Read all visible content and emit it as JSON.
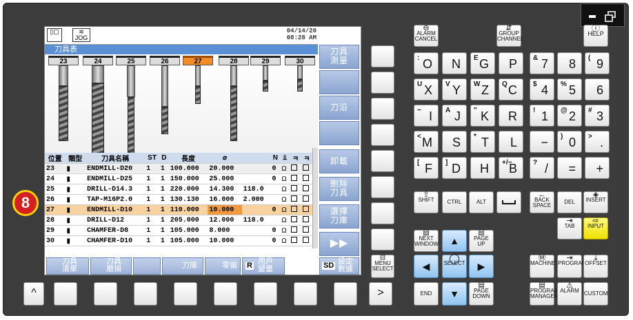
{
  "screen": {
    "date": "04/14/20",
    "time": "08:28 AM",
    "jog_label": "JOG",
    "title": "刀具表",
    "tools": [
      {
        "num": "23"
      },
      {
        "num": "24"
      },
      {
        "num": "25"
      },
      {
        "num": "26"
      },
      {
        "num": "27"
      },
      {
        "num": "28"
      },
      {
        "num": "29"
      },
      {
        "num": "30"
      }
    ],
    "headers": [
      "位置",
      "類型",
      "刀具名稱",
      "ST",
      "D",
      "長度",
      "⌀",
      "",
      "N",
      "",
      "",
      ""
    ],
    "rows": [
      {
        "pos": "23",
        "name": "ENDMILL-D20",
        "st": "1",
        "d": "1",
        "len": "100.000",
        "dia": "20.000",
        "r": "",
        "n": "0"
      },
      {
        "pos": "24",
        "name": "ENDMILL-D25",
        "st": "1",
        "d": "1",
        "len": "150.000",
        "dia": "25.000",
        "r": "",
        "n": "0"
      },
      {
        "pos": "25",
        "name": "DRILL-D14.3",
        "st": "1",
        "d": "1",
        "len": "220.000",
        "dia": "14.300",
        "r": "118.0",
        "n": ""
      },
      {
        "pos": "26",
        "name": "TAP-M16P2.0",
        "st": "1",
        "d": "1",
        "len": "130.130",
        "dia": "16.000",
        "r": "2.000",
        "n": ""
      },
      {
        "pos": "27",
        "name": "ENDMILL-D10",
        "st": "1",
        "d": "1",
        "len": "110.000",
        "dia": "10.000",
        "r": "",
        "n": "0"
      },
      {
        "pos": "28",
        "name": "DRILL-D12",
        "st": "1",
        "d": "1",
        "len": "205.000",
        "dia": "12.000",
        "r": "118.0",
        "n": ""
      },
      {
        "pos": "29",
        "name": "CHAMFER-D8",
        "st": "1",
        "d": "1",
        "len": "105.000",
        "dia": "8.000",
        "r": "",
        "n": "0"
      },
      {
        "pos": "30",
        "name": "CHAMFER-D10",
        "st": "1",
        "d": "1",
        "len": "105.000",
        "dia": "10.000",
        "r": "",
        "n": "0"
      }
    ],
    "soft_right": [
      "刀具\n測量",
      "",
      "刀沿",
      "",
      "卸載",
      "刪除\n刀具",
      "選擇\n刀庫",
      "▶▶"
    ],
    "soft_bottom": [
      "刀具\n清單",
      "刀具\n磨損",
      "刀庫",
      "零偏",
      "用戶\n變量",
      "設定\n數據"
    ],
    "sd_label": "SD",
    "r_label": "R"
  },
  "callout": "8",
  "keys": {
    "alarm_cancel": "ALARM\nCANCEL",
    "group_channel": "GROUP\nCHANNEL",
    "help": "HELP",
    "menu_select": "MENU\nSELECT",
    "up": "^",
    "next": ">",
    "alpha": [
      [
        "O",
        ":"
      ],
      [
        "N",
        ""
      ],
      [
        "G",
        "E"
      ],
      [
        "P",
        ""
      ],
      [
        "X",
        "U"
      ],
      [
        "Y",
        "V"
      ],
      [
        "Z",
        "W"
      ],
      [
        "C",
        "Q"
      ],
      [
        "I",
        "−"
      ],
      [
        "J",
        "A"
      ],
      [
        "K",
        "\""
      ],
      [
        "R",
        ""
      ],
      [
        "M",
        "<"
      ],
      [
        "S",
        ""
      ],
      [
        "T",
        "*"
      ],
      [
        "L",
        ""
      ],
      [
        "F",
        "["
      ],
      [
        "D",
        "]"
      ],
      [
        "H",
        ""
      ],
      [
        "B",
        "+/−"
      ]
    ],
    "num": [
      [
        "7",
        "&"
      ],
      [
        "8",
        ""
      ],
      [
        "9",
        "("
      ],
      [
        "4",
        "$"
      ],
      [
        "5",
        "%"
      ],
      [
        "6",
        ""
      ],
      [
        "1",
        "!"
      ],
      [
        "2",
        "@"
      ],
      [
        "3",
        "#"
      ],
      [
        "−",
        ""
      ],
      [
        "0",
        ")"
      ],
      [
        ".",
        ">"
      ],
      [
        "/",
        "?"
      ],
      [
        "=",
        ""
      ],
      [
        "+",
        ""
      ]
    ],
    "shift": "SHIFT",
    "ctrl": "CTRL",
    "alt": "ALT",
    "back": "BACK\nSPACE",
    "del": "DEL",
    "insert": "INSERT",
    "tab": "TAB",
    "input": "INPUT",
    "next_window": "NEXT\nWINDOW",
    "page_up": "PAGE\nUP",
    "page_down": "PAGE\nDOWN",
    "select": "SELECT",
    "end": "END",
    "machine": "MACHINE",
    "program": "PROGRAM",
    "offset": "OFFSET",
    "prog_manager": "PROGRAM\nMANAGER",
    "alarm": "ALARM",
    "custom": "CUSTOM"
  }
}
